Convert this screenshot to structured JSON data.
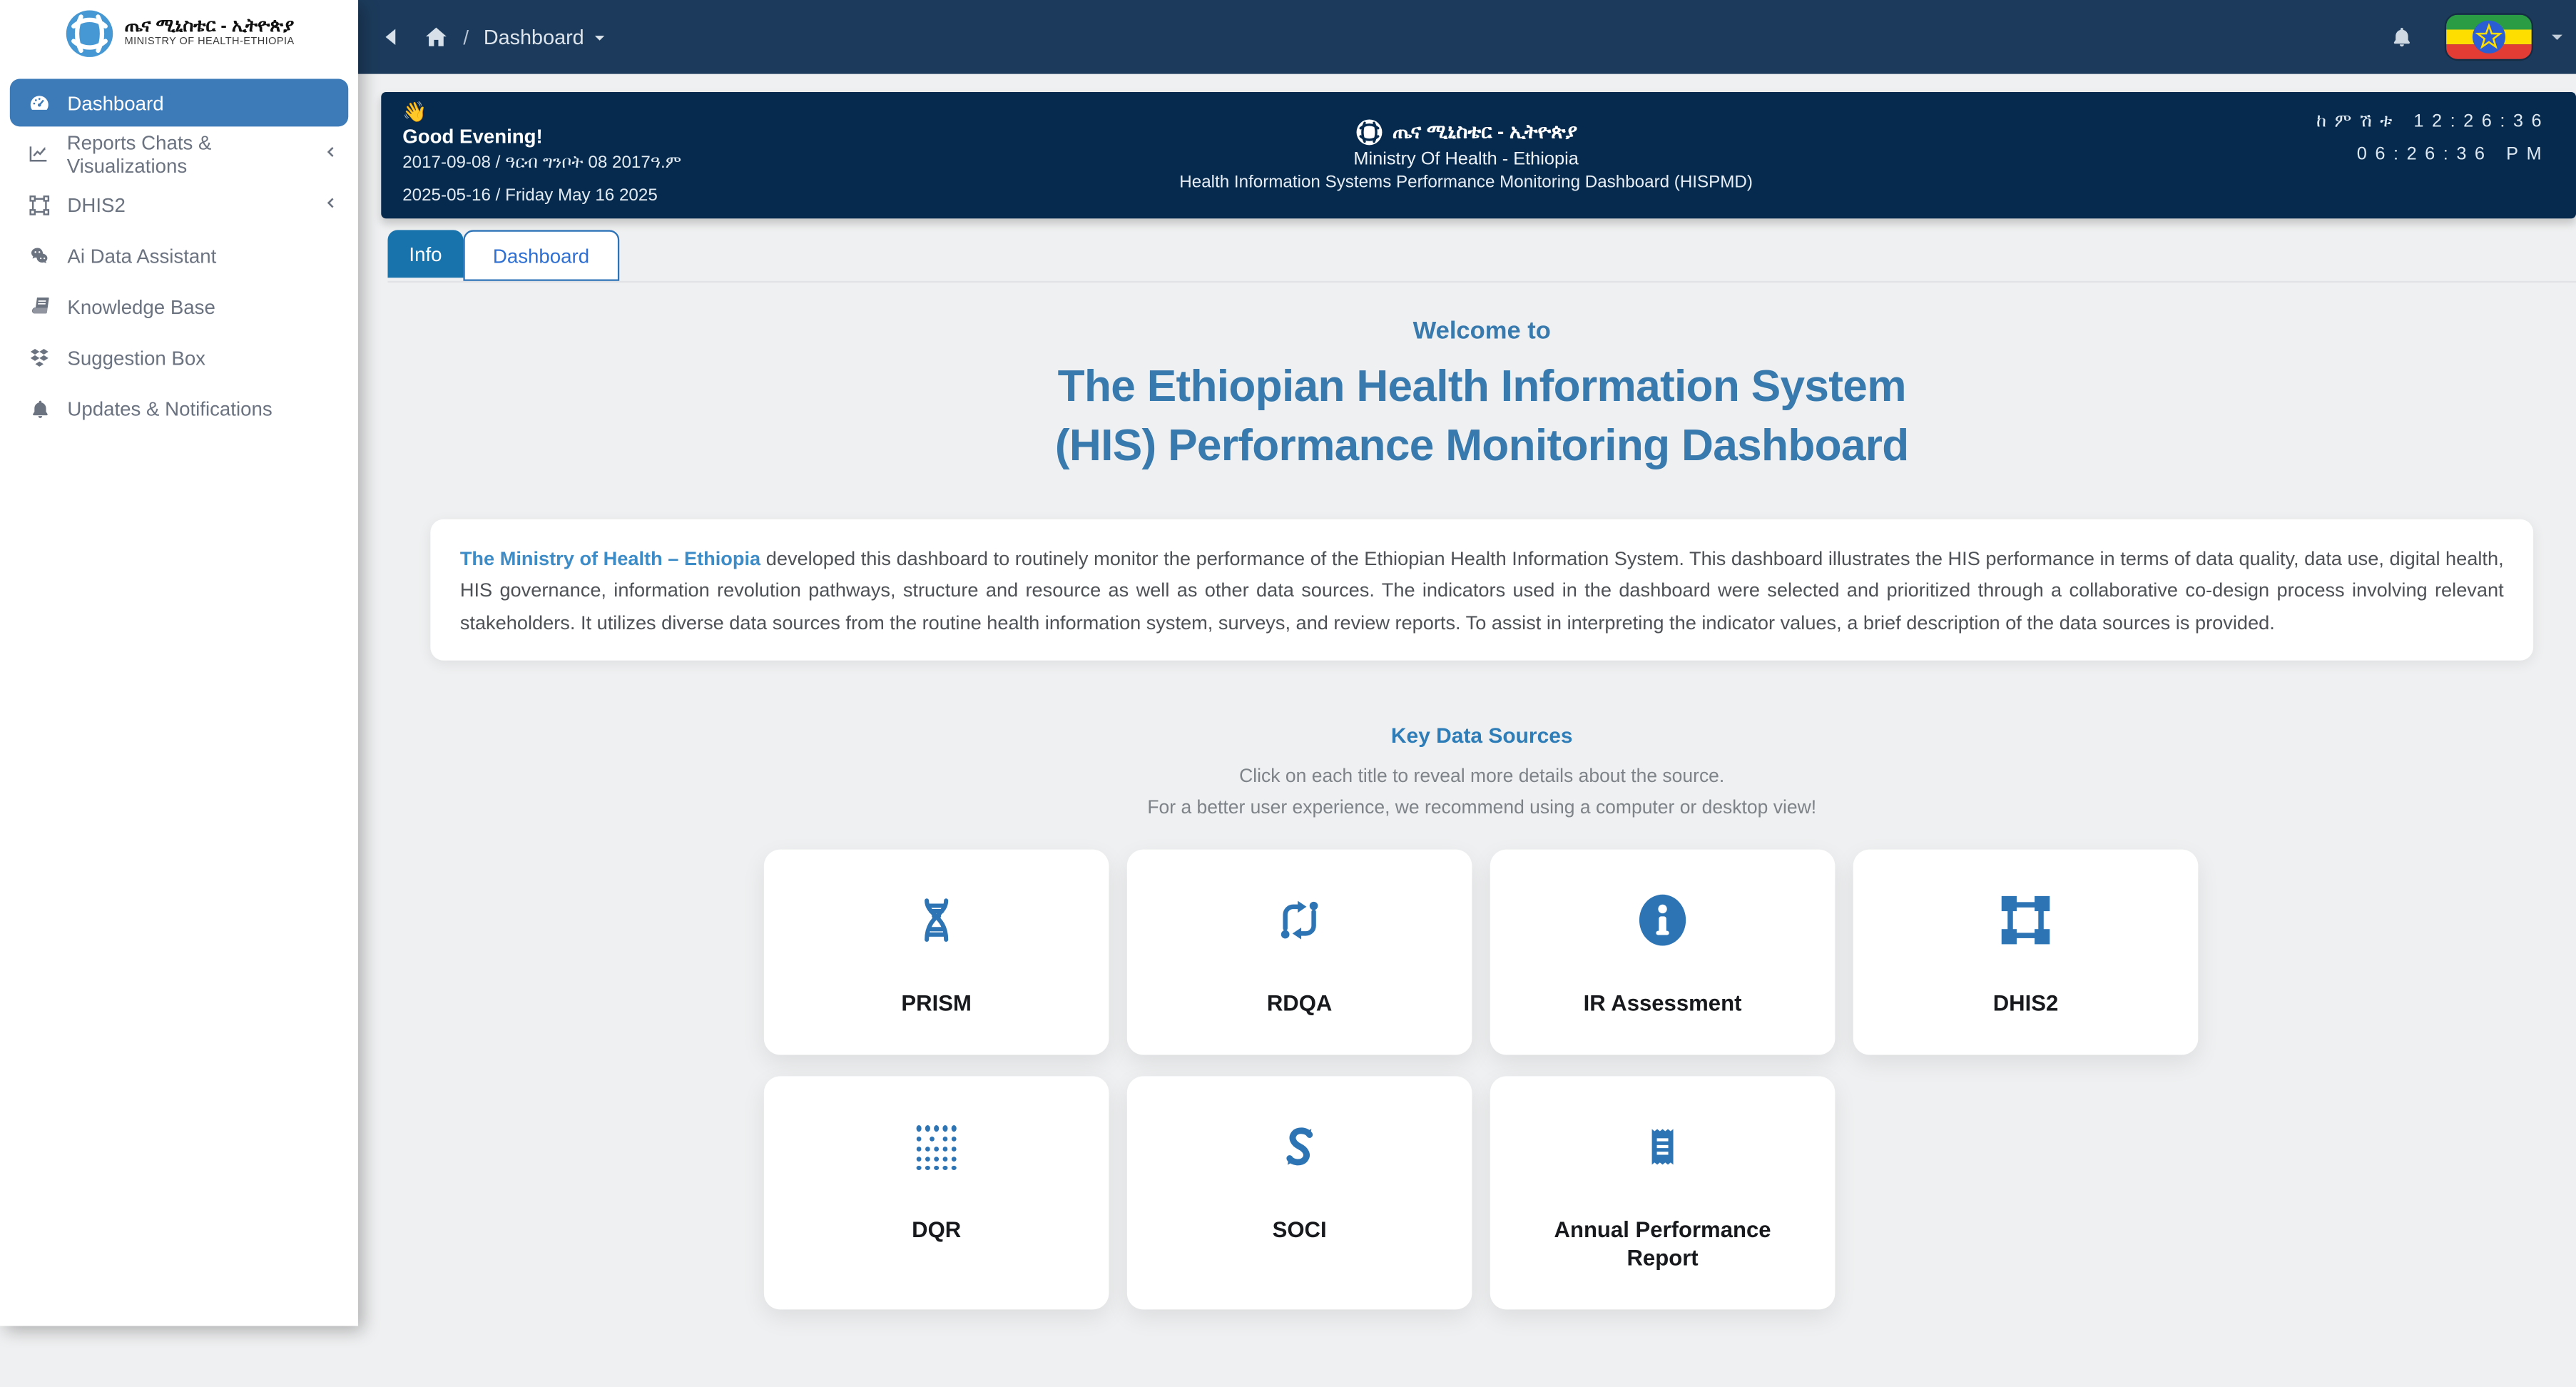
{
  "brand": {
    "name_amharic": "ጤና ሚኒስቴር - ኢትዮጵያ",
    "name_english": "MINISTRY OF HEALTH-ETHIOPIA"
  },
  "navbar": {
    "breadcrumb": "Dashboard"
  },
  "sidebar": {
    "items": [
      {
        "label": "Dashboard",
        "icon": "gauge-icon",
        "active": true
      },
      {
        "label": "Reports Chats & Visualizations",
        "icon": "chart-line-icon",
        "collapsible": true
      },
      {
        "label": "DHIS2",
        "icon": "object-group-icon",
        "collapsible": true
      },
      {
        "label": "Ai Data Assistant",
        "icon": "chat-bubbles-icon"
      },
      {
        "label": "Knowledge Base",
        "icon": "book-icon"
      },
      {
        "label": "Suggestion Box",
        "icon": "dropbox-icon"
      },
      {
        "label": "Updates & Notifications",
        "icon": "bell-icon"
      }
    ]
  },
  "banner": {
    "wave_emoji": "👋",
    "greeting": "Good Evening!",
    "date_ethiopian": "2017-09-08 / ዓርብ ግንቦት 08 2017ዓ.ም",
    "date_gregorian": "2025-05-16 / Friday May 16 2025",
    "org_amharic": "ጤና ሚኒስቴር - ኢትዮጵያ",
    "org_english": "Ministry Of Health - Ethiopia",
    "dashboard_name": "Health Information Systems Performance Monitoring Dashboard (HISPMD)",
    "time_ethiopian": "ከምሽቱ 12:26:36",
    "time_standard": "06:26:36 PM"
  },
  "tabs": [
    {
      "label": "Info",
      "active": true
    },
    {
      "label": "Dashboard",
      "active": false
    }
  ],
  "welcome": {
    "lead": "Welcome to",
    "title_line1": "The Ethiopian Health Information System",
    "title_line2": "(HIS) Performance Monitoring Dashboard"
  },
  "about": {
    "link": "The Ministry of Health – Ethiopia",
    "text": "developed this dashboard to routinely monitor the performance of the Ethiopian Health Information System. This dashboard illustrates the HIS performance in terms of data quality, data use, digital health, HIS governance, information revolution pathways, structure and resource as well as other data sources. The indicators used in the dashboard were selected and prioritized through a collaborative co-design process involving relevant stakeholders. It utilizes diverse data sources from the routine health information system, surveys, and review reports. To assist in interpreting the indicator values, a brief description of the data sources is provided."
  },
  "key_data_sources": {
    "title": "Key Data Sources",
    "hint1": "Click on each title to reveal more details about the source.",
    "hint2": "For a better user experience, we recommend using a computer or desktop view!",
    "cards": [
      {
        "label": "PRISM",
        "icon": "dna-icon"
      },
      {
        "label": "RDQA",
        "icon": "cycle-arrows-icon"
      },
      {
        "label": "IR Assessment",
        "icon": "info-circle-icon"
      },
      {
        "label": "DHIS2",
        "icon": "object-group-icon"
      },
      {
        "label": "DQR",
        "icon": "dot-grid-icon"
      },
      {
        "label": "SOCI",
        "icon": "s-sync-icon"
      },
      {
        "label": "Annual Performance Report",
        "icon": "receipt-icon"
      }
    ]
  },
  "colors": {
    "navbar": "#1c3b5c",
    "banner": "#052a4e",
    "sidebar_active": "#3d7ab8",
    "tab_active": "#1873ad",
    "heading_blue": "#3879ae",
    "link_blue": "#3e8cc7",
    "card_icon_blue": "#2d74b5",
    "page_background": "#eff0f1"
  }
}
